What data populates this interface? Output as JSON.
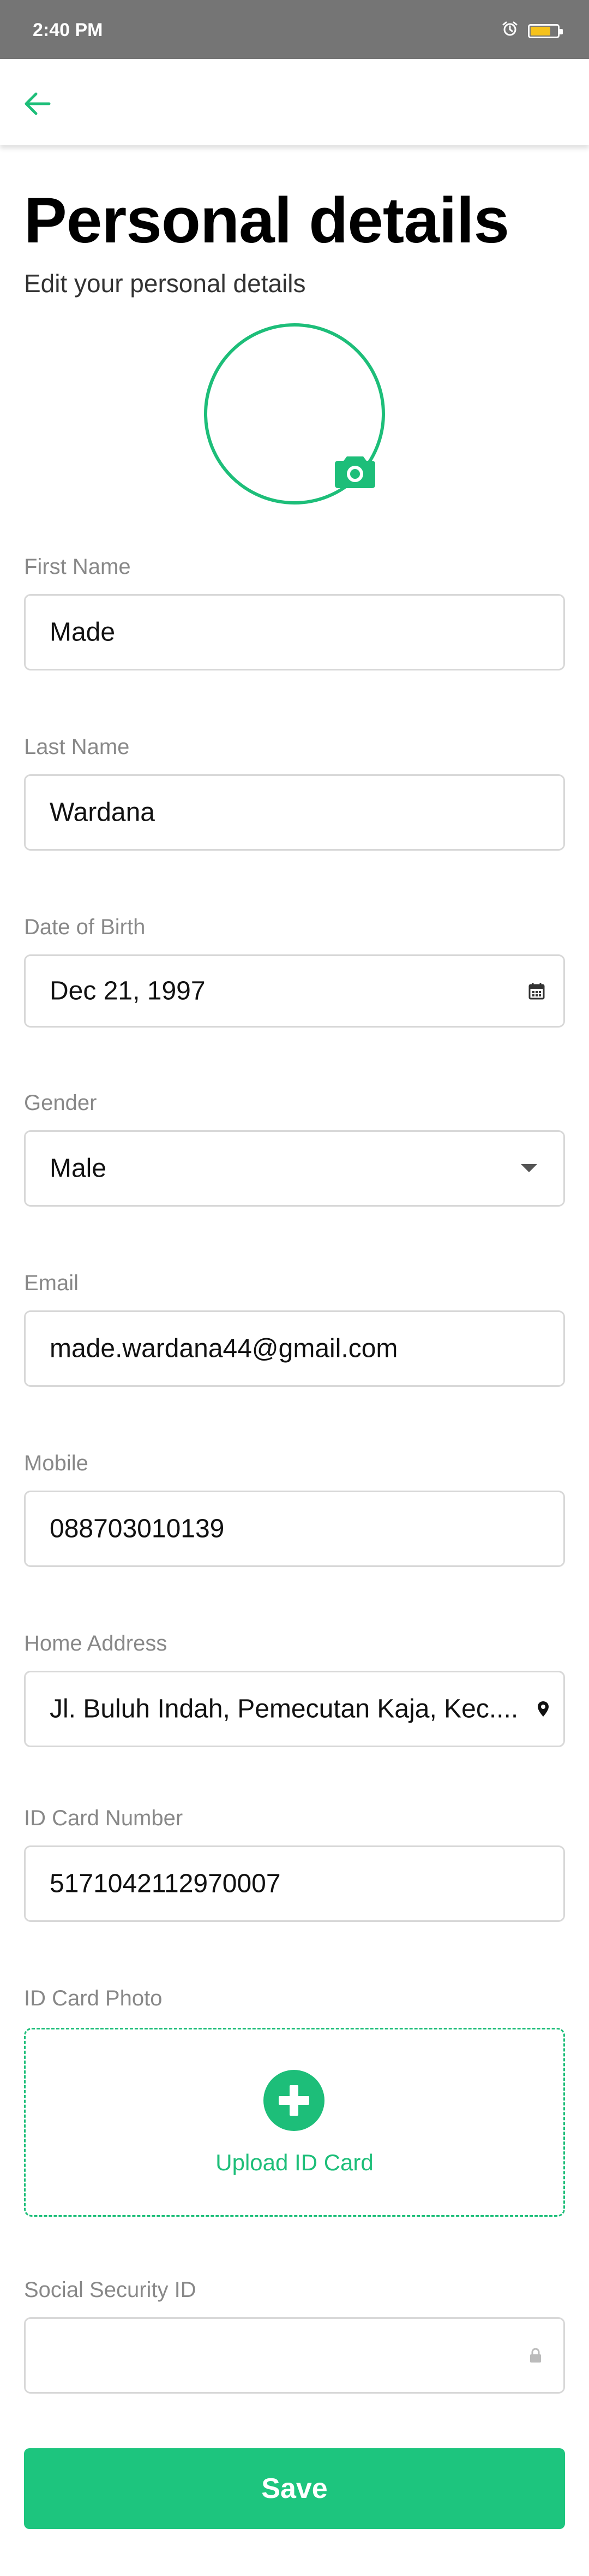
{
  "status_bar": {
    "time": "2:40 PM"
  },
  "header": {
    "title": "Personal details",
    "subtitle": "Edit your personal details"
  },
  "form": {
    "first_name": {
      "label": "First Name",
      "value": "Made"
    },
    "last_name": {
      "label": "Last Name",
      "value": "Wardana"
    },
    "dob": {
      "label": "Date of Birth",
      "value": "Dec 21, 1997"
    },
    "gender": {
      "label": "Gender",
      "value": "Male"
    },
    "email": {
      "label": "Email",
      "value": "made.wardana44@gmail.com"
    },
    "mobile": {
      "label": "Mobile",
      "value": "088703010139"
    },
    "address": {
      "label": "Home Address",
      "value": "Jl. Buluh Indah, Pemecutan Kaja, Kec...."
    },
    "id_card_number": {
      "label": "ID Card Number",
      "value": "5171042112970007"
    },
    "id_card_photo": {
      "label": "ID Card Photo",
      "upload_label": "Upload ID Card"
    },
    "social_security": {
      "label": "Social Security ID",
      "value": ""
    }
  },
  "actions": {
    "save_label": "Save"
  },
  "colors": {
    "accent": "#1dbe79",
    "status_bar": "#757575",
    "border": "#d8d8d8",
    "label": "#888888"
  },
  "icons": [
    "back-arrow-icon",
    "camera-icon",
    "calendar-icon",
    "dropdown-arrow-icon",
    "location-pin-icon",
    "lock-icon",
    "plus-icon",
    "alarm-icon",
    "battery-icon"
  ]
}
